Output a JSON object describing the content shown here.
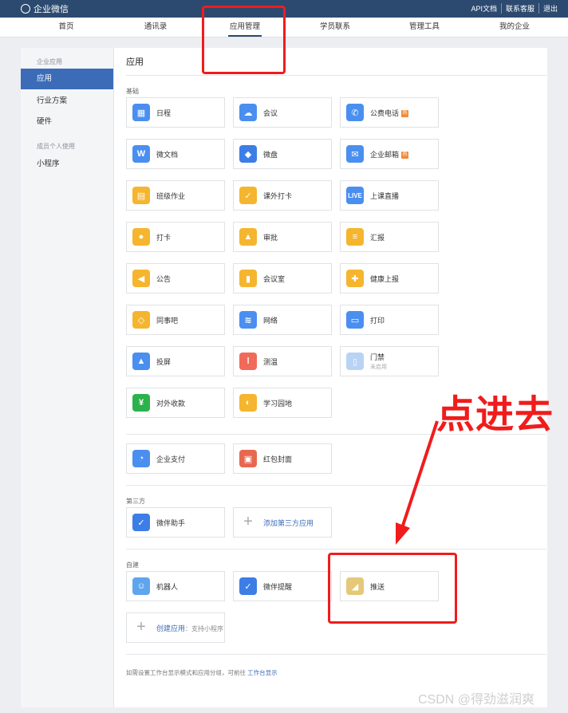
{
  "topbar": {
    "logo": "企业微信",
    "links": [
      "API文档",
      "联系客服",
      "退出"
    ]
  },
  "nav": {
    "items": [
      "首页",
      "通讯录",
      "应用管理",
      "学员联系",
      "管理工具",
      "我的企业"
    ],
    "active_index": 2
  },
  "sidebar": {
    "group1": "企业应用",
    "items1": [
      "应用",
      "行业方案",
      "硬件"
    ],
    "group2": "成员个人使用",
    "items2": [
      "小程序"
    ]
  },
  "main": {
    "title": "应用",
    "basic_label": "基础",
    "basic_apps": [
      {
        "name": "日程",
        "icon": "calendar-icon",
        "color": "#4a8ff0"
      },
      {
        "name": "会议",
        "icon": "meeting-cloud-icon",
        "color": "#4a8ff0"
      },
      {
        "name": "公费电话",
        "icon": "phone-icon",
        "color": "#4a8ff0",
        "badge": "hot-badge"
      },
      {
        "name": "微文档",
        "icon": "document-w-icon",
        "color": "#4a8ff0"
      },
      {
        "name": "微盘",
        "icon": "drive-icon",
        "color": "#3c7ee6"
      },
      {
        "name": "企业邮箱",
        "icon": "mail-icon",
        "color": "#4a8ff0",
        "badge": "hot-badge"
      },
      {
        "name": "班级作业",
        "icon": "homework-icon",
        "color": "#f5b52e"
      },
      {
        "name": "课外打卡",
        "icon": "checkin-card-icon",
        "color": "#f5b52e"
      },
      {
        "name": "上课直播",
        "icon": "live-icon",
        "color": "#4a8ff0"
      },
      {
        "name": "打卡",
        "icon": "location-pin-icon",
        "color": "#f5b52e"
      },
      {
        "name": "审批",
        "icon": "stamp-icon",
        "color": "#f5b52e"
      },
      {
        "name": "汇报",
        "icon": "report-icon",
        "color": "#f5b52e"
      },
      {
        "name": "公告",
        "icon": "megaphone-icon",
        "color": "#f5b52e"
      },
      {
        "name": "会议室",
        "icon": "door-icon",
        "color": "#f5b52e"
      },
      {
        "name": "健康上报",
        "icon": "health-report-icon",
        "color": "#f5b52e"
      },
      {
        "name": "同事吧",
        "icon": "network-icon",
        "color": "#f5b52e"
      },
      {
        "name": "网络",
        "icon": "router-icon",
        "color": "#4a8ff0"
      },
      {
        "name": "打印",
        "icon": "printer-icon",
        "color": "#4a8ff0"
      },
      {
        "name": "投屏",
        "icon": "screencast-icon",
        "color": "#4a8ff0"
      },
      {
        "name": "测温",
        "icon": "thermometer-icon",
        "color": "#f06a5a"
      },
      {
        "name": "门禁",
        "sub": "未启用",
        "icon": "access-control-icon",
        "color": "#b9d3f5"
      },
      {
        "name": "对外收款",
        "icon": "yuan-icon",
        "color": "#2bb24c"
      },
      {
        "name": "学习园地",
        "icon": "planet-icon",
        "color": "#f5b52e"
      }
    ],
    "pay_apps": [
      {
        "name": "企业支付",
        "icon": "pay-icon",
        "color": "#4a8ff0"
      },
      {
        "name": "红包封面",
        "icon": "red-envelope-icon",
        "color": "#e8674f"
      }
    ],
    "third_label": "第三方",
    "third_apps": [
      {
        "name": "微伴助手",
        "icon": "chat-check-icon",
        "color": "#3c7ee6"
      },
      {
        "name": "添加第三方应用",
        "icon": "plus-icon",
        "link": true
      }
    ],
    "custom_label": "自建",
    "custom_apps": [
      {
        "name": "机器人",
        "icon": "robot-icon",
        "color": "#5fa5ee"
      },
      {
        "name": "微伴提醒",
        "icon": "chat-check-icon",
        "color": "#3c7ee6"
      },
      {
        "name": "推送",
        "icon": "push-app-icon",
        "color": "#e6c87a"
      }
    ],
    "create_app": {
      "name": "创建应用",
      "hint": "：支持小程序"
    },
    "footnote_prefix": "如需设置工作台显示模式和应用分组，可前往",
    "footnote_link": "工作台显示"
  },
  "annotation": {
    "text": "点进去",
    "color": "#f01c1c"
  },
  "watermark": "CSDN @得劲滋润爽"
}
